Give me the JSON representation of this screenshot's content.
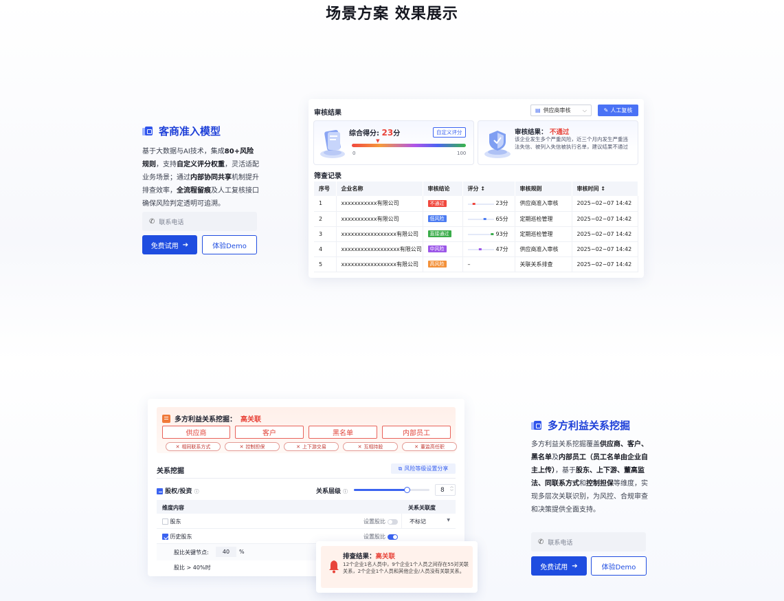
{
  "page": {
    "title": "场景方案 效果展示"
  },
  "section1": {
    "title": "客商准入模型",
    "desc_parts": [
      {
        "t": "基于大数据与AI技术，集成",
        "b": false
      },
      {
        "t": "80+风险规则",
        "b": true
      },
      {
        "t": "，支持",
        "b": false
      },
      {
        "t": "自定义评分权重",
        "b": true
      },
      {
        "t": "，灵活适配业务场景；通过",
        "b": false
      },
      {
        "t": "内部协同共享",
        "b": true
      },
      {
        "t": "机制提升排查效率，",
        "b": false
      },
      {
        "t": "全流程留痕",
        "b": true
      },
      {
        "t": "及人工复核接口确保风险判定透明可追溯。",
        "b": false
      }
    ],
    "phone_placeholder": "联系电话",
    "trial_btn": "免费试用",
    "demo_btn": "体验Demo"
  },
  "panel1": {
    "title": "审核结果",
    "select_value": "供应商审核",
    "manual_btn": "人工复核",
    "score_label": "综合得分:",
    "score_value": "23",
    "score_unit": "分",
    "custom_score_btn": "自定义评分",
    "score_min": "0",
    "score_max": "100",
    "score_fraction": 0.23,
    "result_label": "审核结果：",
    "result_value": "不通过",
    "result_desc": "该企业发生多个严重风险，近三个月内发生严重违法失信、被列入失信被执行名单，建议结果不通过",
    "records_title": "筛查记录",
    "headers": [
      "序号",
      "企业名称",
      "审核结论",
      "评分 ↕",
      "审核规则",
      "审核时间 ↕"
    ],
    "rows": [
      {
        "no": "1",
        "name": "xxxxxxxxxxx有限公司",
        "verdict": "不通过",
        "color": "#f0483e",
        "score": "23分",
        "rule": "供应商准入审核",
        "time": "2025−02−07  14:42"
      },
      {
        "no": "2",
        "name": "xxxxxxxxxxx有限公司",
        "verdict": "低风险",
        "color": "#4c7cf2",
        "score": "65分",
        "rule": "定期巡检管理",
        "time": "2025−02−07  14:42"
      },
      {
        "no": "3",
        "name": "xxxxxxxxxxxxxxxxx有限公司",
        "verdict": "直接通过",
        "color": "#3aac4a",
        "score": "93分",
        "rule": "定期巡检管理",
        "time": "2025−02−07  14:42"
      },
      {
        "no": "4",
        "name": "xxxxxxxxxxxxxxxxxx有限公司",
        "verdict": "中风险",
        "color": "#9b56e8",
        "score": "47分",
        "rule": "供应商准入审核",
        "time": "2025−02−07  14:42"
      },
      {
        "no": "5",
        "name": "xxxxxxxxxxxxxxxxx有限公司",
        "verdict": "高风险",
        "color": "#f3913a",
        "score": "–",
        "rule": "关联关系排查",
        "time": "2025−02−07  14:42"
      }
    ]
  },
  "section2": {
    "title": "多方利益关系挖掘",
    "desc_parts": [
      {
        "t": "多方利益关系挖掘覆盖",
        "b": false
      },
      {
        "t": "供应商、客户、黑名单",
        "b": true
      },
      {
        "t": "及",
        "b": false
      },
      {
        "t": "内部员工（员工名单由企业自主上传）",
        "b": true
      },
      {
        "t": "，基于",
        "b": false
      },
      {
        "t": "股东、上下游、董高监法、同联系方式",
        "b": true
      },
      {
        "t": "和",
        "b": false
      },
      {
        "t": "控制担保",
        "b": true
      },
      {
        "t": "等维度，实现多层次关联识别，为风控、合规审查和决策提供全面支持。",
        "b": false
      }
    ],
    "phone_placeholder": "联系电话",
    "trial_btn": "免费试用",
    "demo_btn": "体验Demo"
  },
  "panel2": {
    "head_label": "多方利益关系挖掘：",
    "head_value": "高关联",
    "entities": [
      "供应商",
      "客户",
      "黑名单",
      "内部员工"
    ],
    "relations": [
      "相同联系方式",
      "控制担保",
      "上下游交易",
      "互相持股",
      "董监高任职"
    ],
    "mining_title": "关系挖掘",
    "share_btn": "风险等级设置分享",
    "group_label": "股权/投资",
    "level_label": "关系层级",
    "level_value": "8",
    "level_fraction": 0.7,
    "col_dim": "维度内容",
    "col_rel": "关系关联度",
    "rows": [
      {
        "label": "股东",
        "checked": false,
        "setting": "设置股比",
        "on": false,
        "rel": "不标记"
      },
      {
        "label": "历史股东",
        "checked": true,
        "setting": "设置股比",
        "on": true,
        "rel": ""
      }
    ],
    "key_node_label": "股比关键节点:",
    "key_node_value": "40",
    "key_node_unit": "%",
    "ratio_label": "股比 > 40%时"
  },
  "alert": {
    "label": "排查结果：",
    "value": "高关联",
    "desc": "12个企业1名人员中，9个企业1个人员之间存在55对关联关系，2个企业1个人员和其他企业/人员没有关联关系。"
  },
  "colors": {
    "accent": "#1f4de0",
    "danger": "#e8443a"
  }
}
